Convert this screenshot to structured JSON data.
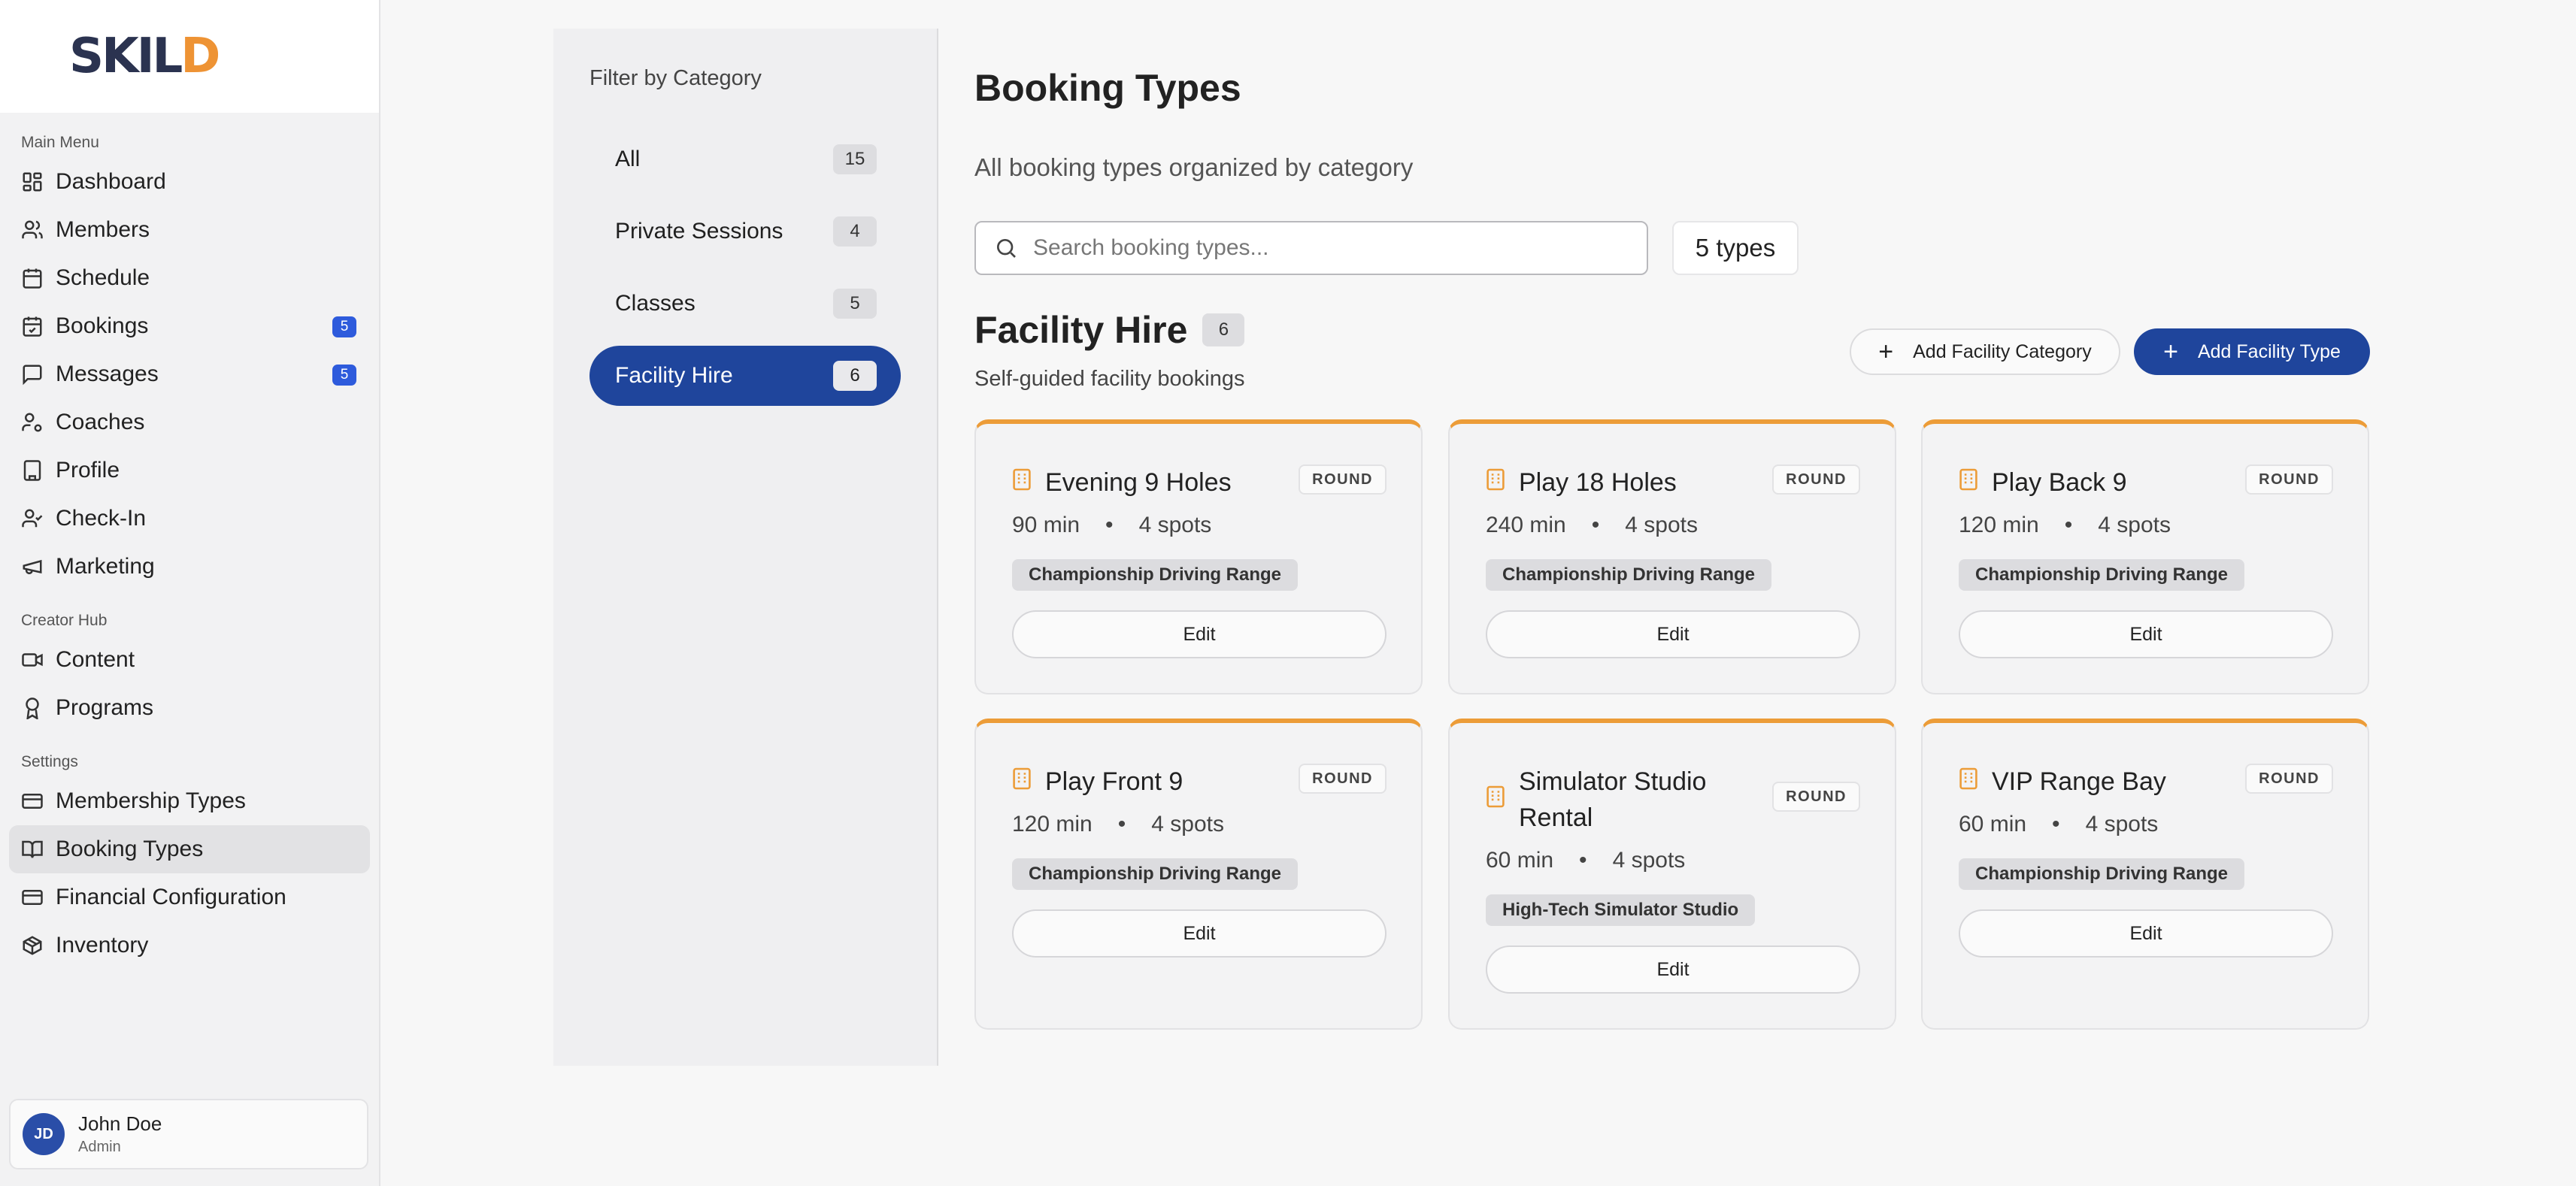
{
  "brand": {
    "logo_main": "SKIL",
    "logo_tail": "D",
    "accent": "#ee9334",
    "primary": "#1f459c"
  },
  "sidebar": {
    "sections": [
      {
        "title": "Main Menu",
        "items": [
          {
            "label": "Dashboard",
            "icon": "grid-icon"
          },
          {
            "label": "Members",
            "icon": "users-icon"
          },
          {
            "label": "Schedule",
            "icon": "calendar-icon"
          },
          {
            "label": "Bookings",
            "icon": "calendar-check-icon",
            "badge": "5"
          },
          {
            "label": "Messages",
            "icon": "message-icon",
            "badge": "5"
          },
          {
            "label": "Coaches",
            "icon": "user-cog-icon"
          },
          {
            "label": "Profile",
            "icon": "building-icon"
          },
          {
            "label": "Check-In",
            "icon": "user-check-icon"
          },
          {
            "label": "Marketing",
            "icon": "megaphone-icon"
          }
        ]
      },
      {
        "title": "Creator Hub",
        "items": [
          {
            "label": "Content",
            "icon": "video-icon"
          },
          {
            "label": "Programs",
            "icon": "award-icon"
          }
        ]
      },
      {
        "title": "Settings",
        "items": [
          {
            "label": "Membership Types",
            "icon": "card-icon"
          },
          {
            "label": "Booking Types",
            "icon": "book-icon",
            "active": true
          },
          {
            "label": "Financial Configuration",
            "icon": "card-icon"
          },
          {
            "label": "Inventory",
            "icon": "package-icon"
          }
        ]
      }
    ],
    "user": {
      "initials": "JD",
      "name": "John Doe",
      "role": "Admin"
    }
  },
  "filter": {
    "title": "Filter by Category",
    "items": [
      {
        "label": "All",
        "count": "15"
      },
      {
        "label": "Private Sessions",
        "count": "4"
      },
      {
        "label": "Classes",
        "count": "5"
      },
      {
        "label": "Facility Hire",
        "count": "6",
        "active": true
      }
    ]
  },
  "main": {
    "title": "Booking Types",
    "subtitle": "All booking types organized by category",
    "search_placeholder": "Search booking types...",
    "types_count": "5 types",
    "section": {
      "name": "Facility Hire",
      "count": "6",
      "description": "Self-guided facility bookings",
      "add_category_label": "Add Facility Category",
      "add_type_label": "Add Facility Type"
    },
    "cards": [
      {
        "title": "Evening 9 Holes",
        "badge": "ROUND",
        "duration": "90 min",
        "spots": "4 spots",
        "tag": "Championship Driving Range",
        "edit": "Edit"
      },
      {
        "title": "Play 18 Holes",
        "badge": "ROUND",
        "duration": "240 min",
        "spots": "4 spots",
        "tag": "Championship Driving Range",
        "edit": "Edit"
      },
      {
        "title": "Play Back 9",
        "badge": "ROUND",
        "duration": "120 min",
        "spots": "4 spots",
        "tag": "Championship Driving Range",
        "edit": "Edit"
      },
      {
        "title": "Play Front 9",
        "badge": "ROUND",
        "duration": "120 min",
        "spots": "4 spots",
        "tag": "Championship Driving Range",
        "edit": "Edit"
      },
      {
        "title": "Simulator Studio Rental",
        "badge": "ROUND",
        "duration": "60 min",
        "spots": "4 spots",
        "tag": "High-Tech Simulator Studio",
        "edit": "Edit"
      },
      {
        "title": "VIP Range Bay",
        "badge": "ROUND",
        "duration": "60 min",
        "spots": "4 spots",
        "tag": "Championship Driving Range",
        "edit": "Edit"
      }
    ],
    "meta_separator": "•"
  }
}
